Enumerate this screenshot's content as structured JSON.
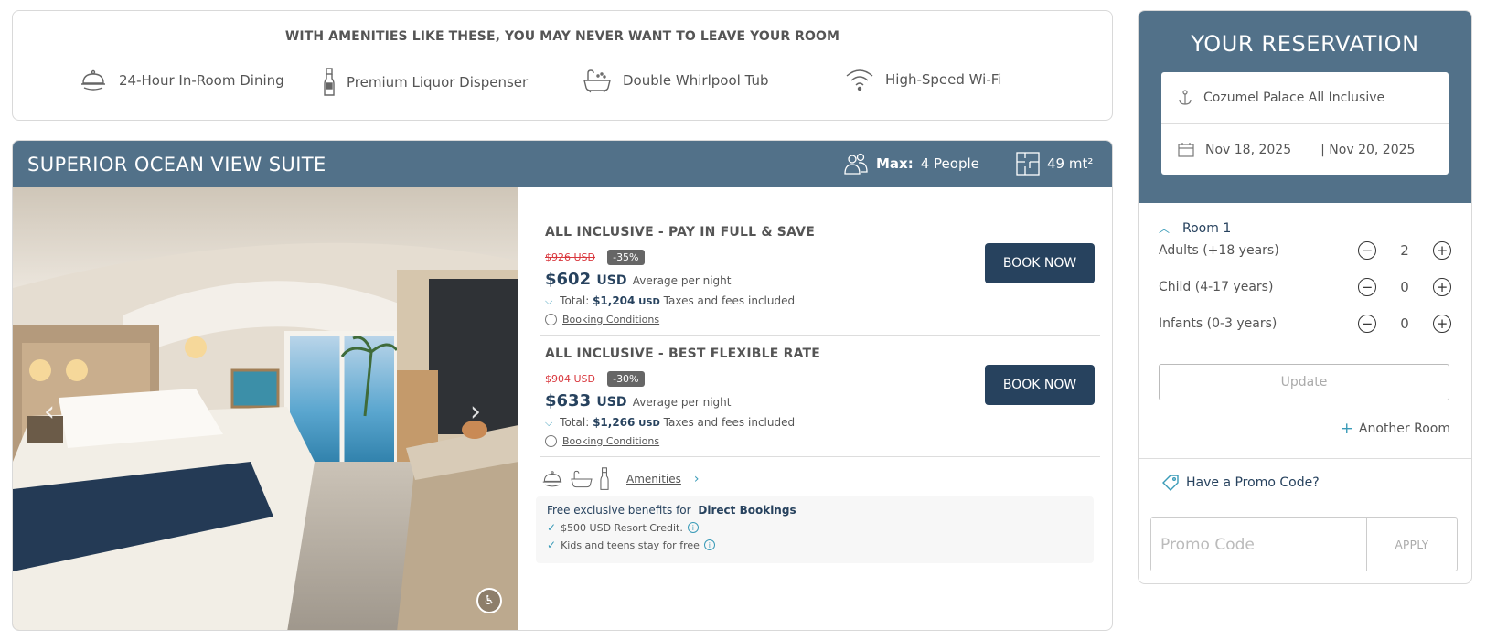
{
  "amenities_banner": {
    "title": "WITH AMENITIES LIKE THESE, YOU MAY NEVER WANT TO LEAVE YOUR ROOM",
    "items": [
      {
        "label": "24-Hour In-Room Dining",
        "icon": "room-service-icon"
      },
      {
        "label": "Premium Liquor Dispenser",
        "icon": "liquor-bottle-icon"
      },
      {
        "label": "Double Whirlpool Tub",
        "icon": "bathtub-icon"
      },
      {
        "label": "High-Speed Wi-Fi",
        "icon": "wifi-icon"
      }
    ]
  },
  "room": {
    "title": "SUPERIOR OCEAN VIEW SUITE",
    "max_label": "Max:",
    "max_value": "4 People",
    "size": "49 mt²",
    "photo_arrow_prev": "‹",
    "photo_arrow_next": "›",
    "rates": [
      {
        "name": "ALL INCLUSIVE - PAY IN FULL & SAVE",
        "old_price": "$926 USD",
        "discount": "-35%",
        "price": "$602",
        "currency": "USD",
        "avg_label": "Average per night",
        "total_label": "Total:",
        "total_value": "$1,204",
        "total_currency": "USD",
        "taxes_label": "Taxes and fees included",
        "conditions_label": "Booking Conditions",
        "book_label": "BOOK NOW"
      },
      {
        "name": "ALL INCLUSIVE - BEST FLEXIBLE RATE",
        "old_price": "$904 USD",
        "discount": "-30%",
        "price": "$633",
        "currency": "USD",
        "avg_label": "Average per night",
        "total_label": "Total:",
        "total_value": "$1,266",
        "total_currency": "USD",
        "taxes_label": "Taxes and fees included",
        "conditions_label": "Booking Conditions",
        "book_label": "BOOK NOW"
      }
    ],
    "amenities_link": "Amenities",
    "benefits": {
      "heading": "Free exclusive benefits for",
      "heading_bold": "Direct Bookings",
      "lines": [
        "$500 USD Resort Credit.",
        "Kids and teens stay for free"
      ]
    }
  },
  "reservation": {
    "title": "YOUR RESERVATION",
    "hotel": "Cozumel Palace All Inclusive",
    "check_in": "Nov 18, 2025",
    "check_out": "| Nov 20, 2025",
    "room_label": "Room 1",
    "guests": [
      {
        "label": "Adults (+18 years)",
        "value": "2"
      },
      {
        "label": "Child (4-17 years)",
        "value": "0"
      },
      {
        "label": "Infants (0-3 years)",
        "value": "0"
      }
    ],
    "update_label": "Update",
    "another_room_label": "Another Room",
    "promo_question": "Have a Promo Code?",
    "promo_placeholder": "Promo Code",
    "apply_label": "APPLY"
  },
  "colors": {
    "header_blue": "#527189",
    "button_navy": "#27425e",
    "accent_teal": "#3a9bb8",
    "sale_red": "#d9373d"
  }
}
